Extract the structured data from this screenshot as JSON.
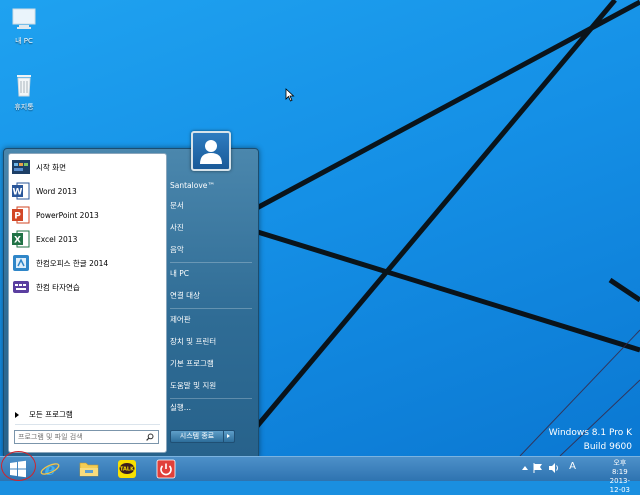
{
  "desktop": {
    "icons": [
      {
        "label": "내 PC",
        "icon": "monitor-icon"
      },
      {
        "label": "휴지통",
        "icon": "recycle-bin-icon"
      }
    ],
    "watermark": {
      "line1": "Windows 8.1 Pro K",
      "line2": "Build 9600"
    }
  },
  "start_menu": {
    "programs": [
      {
        "label": "시작 화면",
        "icon": "start-screen-icon"
      },
      {
        "label": "Word 2013",
        "icon": "word-icon"
      },
      {
        "label": "PowerPoint 2013",
        "icon": "powerpoint-icon"
      },
      {
        "label": "Excel 2013",
        "icon": "excel-icon"
      },
      {
        "label": "한컴오피스 한글 2014",
        "icon": "hangul-icon"
      },
      {
        "label": "한컴 타자연습",
        "icon": "typing-practice-icon"
      }
    ],
    "all_programs": "모든 프로그램",
    "search_placeholder": "프로그램 및 파일 검색",
    "right_items": [
      "Santalove™",
      "문서",
      "사진",
      "음악",
      "내 PC",
      "연결 대상",
      "제어판",
      "장치 및 프린터",
      "기본 프로그램",
      "도움말 및 지원",
      "실행..."
    ],
    "shutdown_label": "시스템 종료"
  },
  "taskbar": {
    "apps": [
      "internet-explorer-icon",
      "file-explorer-icon",
      "kakaotalk-icon",
      "shutdown-app-icon"
    ],
    "kakao_text": "TALK",
    "tray": {
      "ime": "A",
      "time": "오후 8:19",
      "date": "2013-12-03"
    }
  },
  "colors": {
    "desktop_blue": "#1590e6",
    "start_menu_blue": "#2f6c95",
    "taskbar_blue": "#2e73b0",
    "highlight_red": "#d0232b"
  }
}
